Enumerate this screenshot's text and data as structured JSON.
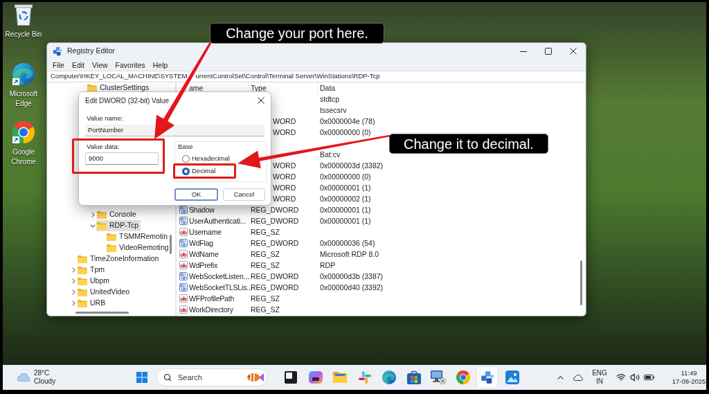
{
  "desktop_icons": [
    {
      "label": "Recycle Bin"
    },
    {
      "label": "Microsoft Edge"
    },
    {
      "label": "Google Chrome"
    }
  ],
  "registry_editor": {
    "title": "Registry Editor",
    "menu": [
      "File",
      "Edit",
      "View",
      "Favorites",
      "Help"
    ],
    "address": [
      "Computer\\HKEY_LOCAL_MACHINE\\SYSTEM",
      "urrentControlSet\\Control\\Terminal Server\\WinStations\\RDP-Tcp"
    ],
    "tree": [
      {
        "children": [
          {
            "label": "ClusterSettings",
            "selected": false
          },
          {
            "children": [
              {
                "label": "Console",
                "expanded": false,
                "selected": false
              },
              {
                "label": "RDP-Tcp",
                "expanded": true,
                "selected": true,
                "children": [
                  {
                    "label": "TSMMRemotin",
                    "selected": false
                  },
                  {
                    "label": "VideoRemoting",
                    "selected": false
                  }
                ]
              }
            ]
          }
        ]
      },
      {
        "label": "TimeZoneInformation",
        "selected": false
      },
      {
        "label": "Tpm",
        "expanded": false,
        "selected": false
      },
      {
        "label": "Ubpm",
        "expanded": false,
        "selected": false
      },
      {
        "label": "UnitedVideo",
        "expanded": false,
        "selected": false
      },
      {
        "label": "URB",
        "expanded": false,
        "selected": false
      }
    ],
    "columns": [
      "ame",
      "Type",
      "Data"
    ],
    "rows": [
      {
        "kind": "covered",
        "data": "stdtcp"
      },
      {
        "kind": "covered",
        "data": "tssecsrv"
      },
      {
        "kind": "covered",
        "type": "WORD",
        "data": "0x0000004e (78)"
      },
      {
        "kind": "covered",
        "type": "WORD",
        "data": "0x00000000 (0)"
      },
      {
        "kind": "covered"
      },
      {
        "kind": "covered",
        "data": "Bat:cv"
      },
      {
        "kind": "covered",
        "type": "WORD",
        "data": "0x0000003d (3382)"
      },
      {
        "kind": "covered",
        "type": "WORD",
        "data": "0x00000000 (0)"
      },
      {
        "kind": "covered",
        "type": "WORD",
        "data": "0x00000001 (1)"
      },
      {
        "kind": "covered",
        "type": "WORD",
        "data": "0x00000002 (1)"
      },
      {
        "kind": "dword",
        "name": "Shadow",
        "type": "REG_DWORD",
        "data": "0x00000001 (1)"
      },
      {
        "kind": "dword",
        "name": "UserAuthenticati...",
        "type": "REG_DWORD",
        "data": "0x00000001 (1)"
      },
      {
        "kind": "sz",
        "name": "Username",
        "type": "REG_SZ"
      },
      {
        "kind": "dword",
        "name": "WdFlag",
        "type": "REG_DWORD",
        "data": "0x00000036 (54)"
      },
      {
        "kind": "sz",
        "name": "WdName",
        "type": "REG_SZ",
        "data": "Microsoft RDP 8.0"
      },
      {
        "kind": "sz",
        "name": "WdPrefix",
        "type": "REG_SZ",
        "data": "RDP"
      },
      {
        "kind": "dword",
        "name": "WebSocketListen...",
        "type": "REG_DWORD",
        "data": "0x00000d3b (3387)"
      },
      {
        "kind": "dword",
        "name": "WebSocketTLSLis...",
        "type": "REG_DWORD",
        "data": "0x00000d40 (3392)"
      },
      {
        "kind": "sz",
        "name": "WFProfilePath",
        "type": "REG_SZ"
      },
      {
        "kind": "sz",
        "name": "WorkDirectory",
        "type": "REG_SZ"
      }
    ]
  },
  "dialog": {
    "title": "Edit DWORD (32-bit) Value",
    "value_name_label": "Value name:",
    "value_name": "PortNumber",
    "value_data_label": "Value data:",
    "value_data": "9000",
    "base": {
      "label": "Base",
      "options": [
        {
          "label": "Hexadecimal",
          "selected": false
        },
        {
          "label": "Decimal",
          "selected": true
        }
      ]
    },
    "buttons": [
      {
        "label": "OK",
        "focused": true
      },
      {
        "label": "Cancel",
        "focused": false
      }
    ]
  },
  "callouts": [
    "Change your port here.",
    "Change it to decimal."
  ],
  "taskbar": {
    "weather": {
      "temperature": "28°C",
      "condition": "Cloudy"
    },
    "search": {
      "placeholder": "Search"
    },
    "apps": [
      {
        "active": false
      },
      {
        "active": false
      },
      {
        "active": false
      },
      {
        "active": false
      },
      {
        "active": false
      },
      {
        "active": false
      },
      {
        "active": false
      },
      {
        "active": false
      },
      {
        "active": true
      },
      {
        "active": false
      }
    ],
    "tray": {
      "language": "ENG",
      "region": "IN",
      "time": "11:49",
      "date": "17-08-2025"
    }
  }
}
